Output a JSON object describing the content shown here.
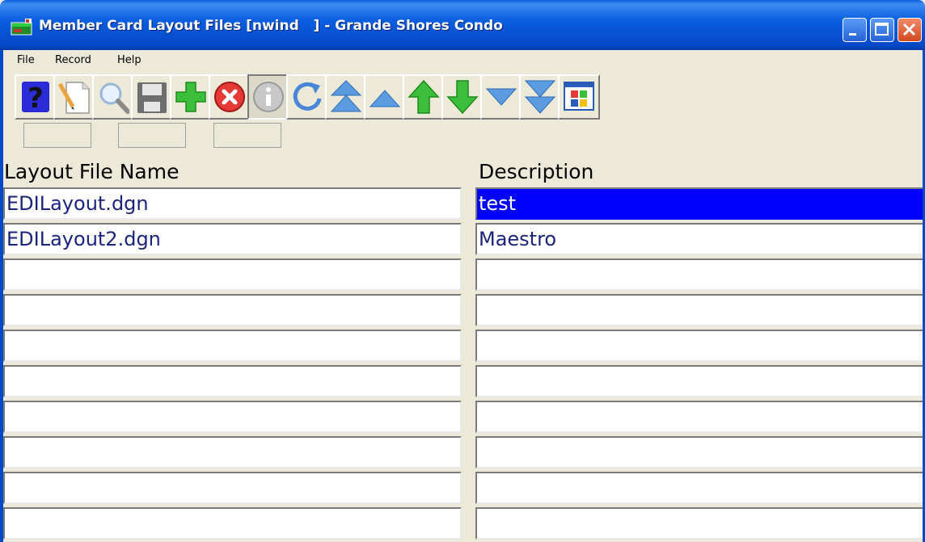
{
  "window": {
    "title": "Member Card Layout Files [nwind   ] - Grande Shores Condo"
  },
  "menu": [
    {
      "label": "File"
    },
    {
      "label": "Record"
    },
    {
      "label": "Help"
    }
  ],
  "toolbar": [
    {
      "icon": "help-icon"
    },
    {
      "icon": "new-document-icon"
    },
    {
      "icon": "search-icon"
    },
    {
      "icon": "save-icon"
    },
    {
      "icon": "add-icon"
    },
    {
      "icon": "delete-icon"
    },
    {
      "icon": "info-icon"
    },
    {
      "icon": "refresh-icon"
    },
    {
      "icon": "first-record-icon"
    },
    {
      "icon": "previous-page-icon"
    },
    {
      "icon": "previous-record-icon"
    },
    {
      "icon": "next-record-icon"
    },
    {
      "icon": "next-page-icon"
    },
    {
      "icon": "last-record-icon"
    },
    {
      "icon": "windows-app-icon"
    }
  ],
  "grid": {
    "columns": [
      "Layout File Name",
      "Description"
    ],
    "rows": [
      [
        "EDILayout.dgn",
        "test"
      ],
      [
        "EDILayout2.dgn",
        "Maestro"
      ],
      [
        "",
        ""
      ],
      [
        "",
        ""
      ],
      [
        "",
        ""
      ],
      [
        "",
        ""
      ],
      [
        "",
        ""
      ],
      [
        "",
        ""
      ],
      [
        "",
        ""
      ],
      [
        "",
        ""
      ]
    ],
    "selected_cell": "test"
  },
  "colors": {
    "titlebar": "#0a5fe0",
    "selection": "#0000ff",
    "cell_text": "#1a237e"
  }
}
